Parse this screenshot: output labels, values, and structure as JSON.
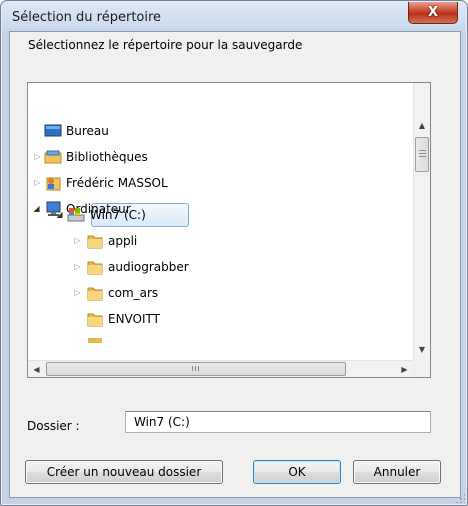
{
  "window": {
    "title": "Sélection du répertoire",
    "close_glyph": "X"
  },
  "instruction": "Sélectionnez le répertoire pour la sauvegarde",
  "tree": {
    "items": [
      {
        "label": "Bureau",
        "icon": "desktop-icon",
        "expander": ""
      },
      {
        "label": "Bibliothèques",
        "icon": "libraries-icon",
        "expander": "▷"
      },
      {
        "label": "Frédéric MASSOL",
        "icon": "user-folder-icon",
        "expander": "▷"
      },
      {
        "label": "Ordinateur",
        "icon": "computer-icon",
        "expander": "◢"
      },
      {
        "label": "Win7 (C:)",
        "icon": "drive-icon",
        "expander": "◢",
        "selected": true
      },
      {
        "label": "appli",
        "icon": "folder-icon",
        "expander": "▷"
      },
      {
        "label": "audiograbber",
        "icon": "folder-icon",
        "expander": "▷"
      },
      {
        "label": "com_ars",
        "icon": "folder-icon",
        "expander": "▷"
      },
      {
        "label": "ENVOITT",
        "icon": "folder-icon",
        "expander": ""
      }
    ],
    "vscroll": {
      "up": "▲",
      "down": "▼"
    },
    "hscroll": {
      "left": "◀",
      "right": "▶",
      "grip": "III"
    }
  },
  "folder": {
    "label": "Dossier :",
    "value": "Win7 (C:)"
  },
  "buttons": {
    "new_folder": "Créer un nouveau dossier",
    "ok": "OK",
    "cancel": "Annuler"
  },
  "colors": {
    "selection_border": "#84acdd",
    "folder_yellow": "#e8b84a",
    "close_red": "#c8442b"
  }
}
